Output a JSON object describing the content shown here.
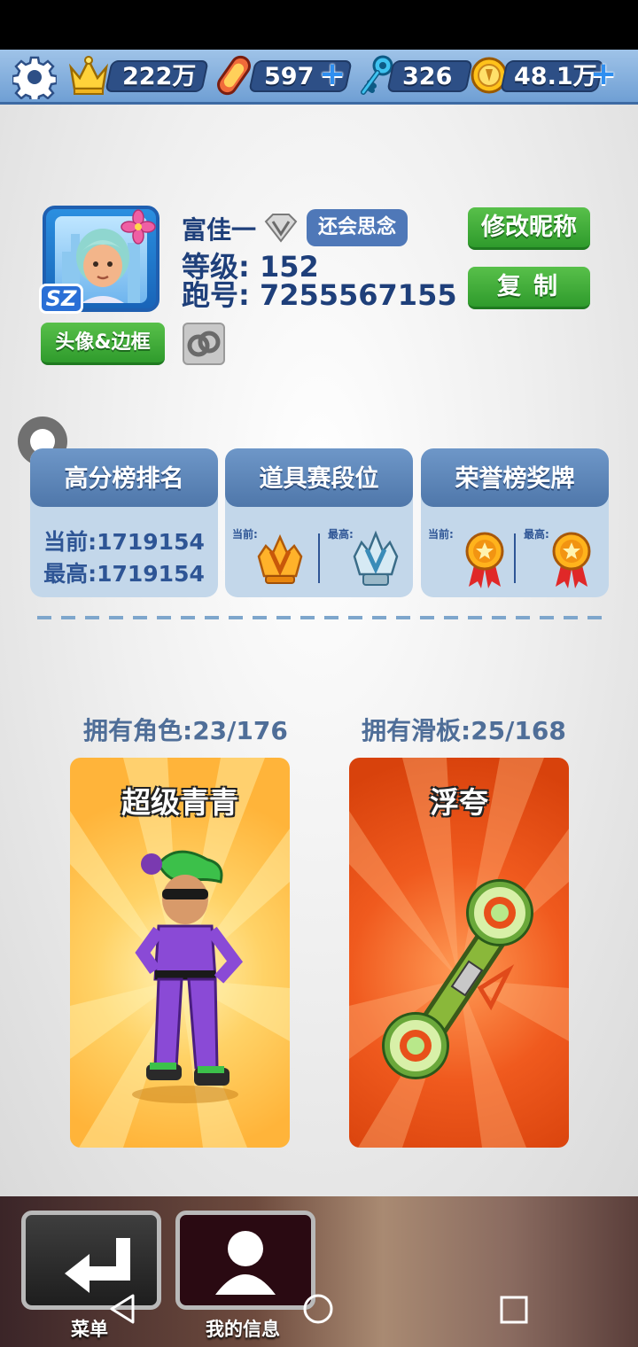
{
  "topbar": {
    "crowns": "222万",
    "boards": "597",
    "keys": "326",
    "coins": "48.1万"
  },
  "profile": {
    "name": "富佳一",
    "title_tag": "还会思念",
    "level": "等级: 152",
    "run_id": "跑号: 7255567155",
    "avatar_badge": "SZ",
    "rename_button": "修改昵称",
    "copy_button": "复制",
    "avatar_frame_button": "头像&边框"
  },
  "cards": {
    "leaderboard": {
      "title": "高分榜排名",
      "current": "当前:1719154",
      "best": "最高:1719154"
    },
    "item_rank": {
      "title": "道具赛段位",
      "current_label": "当前:",
      "best_label": "最高:"
    },
    "honor": {
      "title": "荣誉榜奖牌",
      "current_label": "当前:",
      "best_label": "最高:"
    }
  },
  "collection": {
    "characters_owned": "拥有角色:23/176",
    "boards_owned": "拥有滑板:25/168",
    "character_name": "超级青青",
    "board_name": "浮夸"
  },
  "bottom_nav": {
    "menu": "菜单",
    "my_info": "我的信息"
  },
  "colors": {
    "accent_green": "#3aa836",
    "header_blue": "#5b83b8",
    "text_navy": "#1e3f7a"
  }
}
